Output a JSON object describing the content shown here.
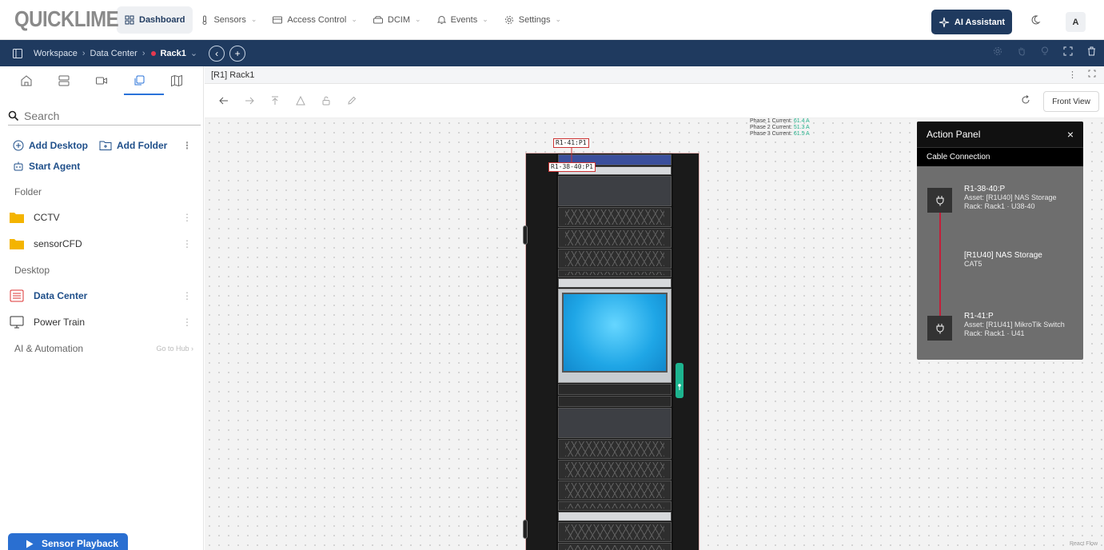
{
  "brand": {
    "logo": "QUICKLIME"
  },
  "nav": {
    "items": [
      {
        "label": "Dashboard"
      },
      {
        "label": "Sensors"
      },
      {
        "label": "Access Control"
      },
      {
        "label": "DCIM"
      },
      {
        "label": "Events"
      },
      {
        "label": "Settings"
      }
    ],
    "ai_label": "AI Assistant",
    "avatar": "A"
  },
  "breadcrumb": {
    "items": [
      "Workspace",
      "Data Center",
      "Rack1"
    ]
  },
  "sidebar": {
    "search_placeholder": "Search",
    "add_desktop": "Add Desktop",
    "add_folder": "Add Folder",
    "start_agent": "Start Agent",
    "folder_label": "Folder",
    "folders": [
      "CCTV",
      "sensorCFD"
    ],
    "desktop_label": "Desktop",
    "desktops": [
      "Data Center",
      "Power Train"
    ],
    "ai_label": "AI & Automation",
    "go_hub": "Go to Hub ›",
    "playback": "Sensor Playback"
  },
  "main": {
    "title": "[R1] Rack1",
    "front_view": "Front View",
    "phases": [
      {
        "label": "Phase 1 Current:",
        "value": "61.4 A"
      },
      {
        "label": "Phase 2 Current:",
        "value": "51.3 A"
      },
      {
        "label": "Phase 3 Current:",
        "value": "61.5 A"
      }
    ],
    "tags": [
      "R1-41:P1",
      "R1-38-40:P1"
    ],
    "react_flow": "React Flow"
  },
  "action_panel": {
    "title": "Action Panel",
    "subtitle": "Cable Connection",
    "from": {
      "port": "R1-38-40:P",
      "asset": "Asset: [R1U40] NAS Storage",
      "rack": "Rack: Rack1 · U38-40"
    },
    "cable": {
      "name": "[R1U40] NAS Storage",
      "type": "CAT5"
    },
    "to": {
      "port": "R1-41:P",
      "asset": "Asset: [R1U41] MikroTik Switch",
      "rack": "Rack: Rack1 · U41"
    }
  },
  "colors": {
    "navy": "#1f3a5f",
    "accent": "#2a6fd1",
    "cable": "#c31f3a",
    "phase_value": "#21b08a"
  }
}
